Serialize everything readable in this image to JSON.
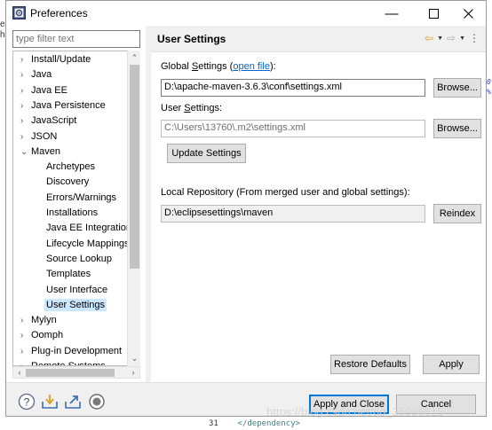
{
  "window": {
    "title": "Preferences",
    "minimize_glyph": "—",
    "maximize_glyph": "☐",
    "close_glyph": "✕"
  },
  "background": {
    "left_chars": [
      "e",
      "h"
    ],
    "right_chars": [
      "0",
      "%,"
    ],
    "code_line_number": "31",
    "code_line_text": "</dependency>",
    "watermark": "https://blog.csdn.net/qq_35996615"
  },
  "sidebar": {
    "filter_placeholder": "type filter text",
    "items": [
      {
        "arrow": "›",
        "label": "Install/Update",
        "level": 0
      },
      {
        "arrow": "›",
        "label": "Java",
        "level": 0
      },
      {
        "arrow": "›",
        "label": "Java EE",
        "level": 0
      },
      {
        "arrow": "›",
        "label": "Java Persistence",
        "level": 0
      },
      {
        "arrow": "›",
        "label": "JavaScript",
        "level": 0
      },
      {
        "arrow": "›",
        "label": "JSON",
        "level": 0
      },
      {
        "arrow": "⌄",
        "label": "Maven",
        "level": 0
      },
      {
        "arrow": "",
        "label": "Archetypes",
        "level": 1
      },
      {
        "arrow": "",
        "label": "Discovery",
        "level": 1
      },
      {
        "arrow": "",
        "label": "Errors/Warnings",
        "level": 1
      },
      {
        "arrow": "",
        "label": "Installations",
        "level": 1
      },
      {
        "arrow": "",
        "label": "Java EE Integration",
        "level": 1
      },
      {
        "arrow": "",
        "label": "Lifecycle Mappings",
        "level": 1
      },
      {
        "arrow": "",
        "label": "Source Lookup",
        "level": 1
      },
      {
        "arrow": "",
        "label": "Templates",
        "level": 1
      },
      {
        "arrow": "",
        "label": "User Interface",
        "level": 1
      },
      {
        "arrow": "",
        "label": "User Settings",
        "level": 1,
        "selected": true
      },
      {
        "arrow": "›",
        "label": "Mylyn",
        "level": 0
      },
      {
        "arrow": "›",
        "label": "Oomph",
        "level": 0
      },
      {
        "arrow": "›",
        "label": "Plug-in Development",
        "level": 0
      },
      {
        "arrow": "›",
        "label": "Remote Systems",
        "level": 0
      }
    ],
    "scroll_up": "⌃",
    "scroll_down": "⌄",
    "scroll_left": "‹",
    "scroll_right": "›"
  },
  "page": {
    "title": "User Settings",
    "global_label_pre": "Global ",
    "global_label_mnemonic": "S",
    "global_label_post": "ettings (",
    "global_link": "open file",
    "global_label_end": "):",
    "global_value": "D:\\apache-maven-3.6.3\\conf\\settings.xml",
    "browse_label": "Browse...",
    "user_label_pre": "User ",
    "user_label_mnemonic": "S",
    "user_label_post": "ettings:",
    "user_value": "C:\\Users\\13760\\.m2\\settings.xml",
    "update_label": "Update Settings",
    "local_repo_label": "Local Repository (From merged user and global settings):",
    "local_repo_value": "D:\\eclipsesettings\\maven",
    "reindex_label": "Reindex",
    "restore_defaults_label": "Restore Defaults",
    "apply_label": "Apply"
  },
  "footer": {
    "apply_close_label": "Apply and Close",
    "cancel_label": "Cancel"
  },
  "colors": {
    "selection": "#cce8ff",
    "link": "#0066cc",
    "default_button_border": "#0078d7"
  }
}
